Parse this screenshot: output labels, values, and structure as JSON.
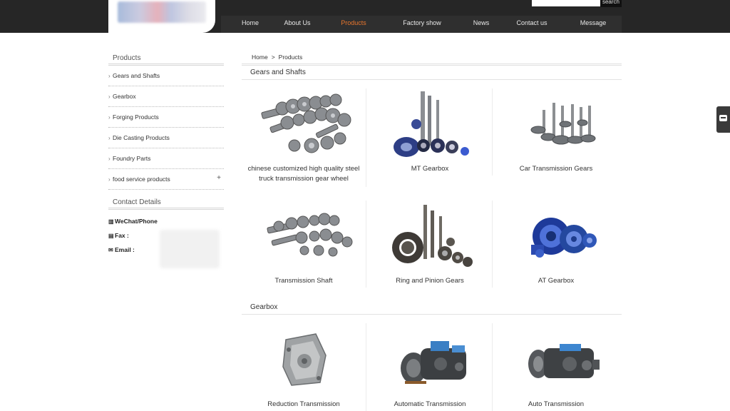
{
  "header": {
    "search_button": "search",
    "search_value": "",
    "nav": [
      {
        "label": "Home"
      },
      {
        "label": "About Us"
      },
      {
        "label": "Products",
        "active": true
      },
      {
        "label": "Factory show"
      },
      {
        "label": "News"
      },
      {
        "label": "Contact us"
      },
      {
        "label": "Message"
      }
    ],
    "active_color": "#e8762d"
  },
  "sidebar": {
    "title": "Products",
    "items": [
      {
        "label": "Gears and Shafts"
      },
      {
        "label": "Gearbox"
      },
      {
        "label": "Forging Products"
      },
      {
        "label": "Die Casting Products"
      },
      {
        "label": "Foundry Parts"
      },
      {
        "label": "food service products",
        "expand": "+"
      }
    ],
    "contact_title": "Contact Details",
    "contacts": [
      {
        "label": "WeChat/Phone",
        "icon": "phone-icon"
      },
      {
        "label": "Fax :",
        "icon": "fax-icon"
      },
      {
        "label": "Email :",
        "icon": "email-icon"
      }
    ]
  },
  "breadcrumb": {
    "home": "Home",
    "separator": ">",
    "current": "Products"
  },
  "sections": [
    {
      "title": "Gears and Shafts",
      "products": [
        {
          "name": "chinese customized high quality steel truck transmission gear wheel",
          "icon": "gear-set-image"
        },
        {
          "name": "MT Gearbox",
          "icon": "mt-gearbox-image"
        },
        {
          "name": "Car Transmission Gears",
          "icon": "car-gears-image"
        },
        {
          "name": "Transmission Shaft",
          "icon": "transmission-shaft-image"
        },
        {
          "name": "Ring and Pinion Gears",
          "icon": "ring-pinion-image"
        },
        {
          "name": "AT Gearbox",
          "icon": "at-gearbox-image"
        }
      ]
    },
    {
      "title": "Gearbox",
      "products": [
        {
          "name": "Reduction Transmission",
          "icon": "reduction-transmission-image"
        },
        {
          "name": "Automatic Transmission",
          "icon": "automatic-transmission-image"
        },
        {
          "name": "Auto Transmission",
          "icon": "auto-transmission-image"
        }
      ]
    }
  ]
}
